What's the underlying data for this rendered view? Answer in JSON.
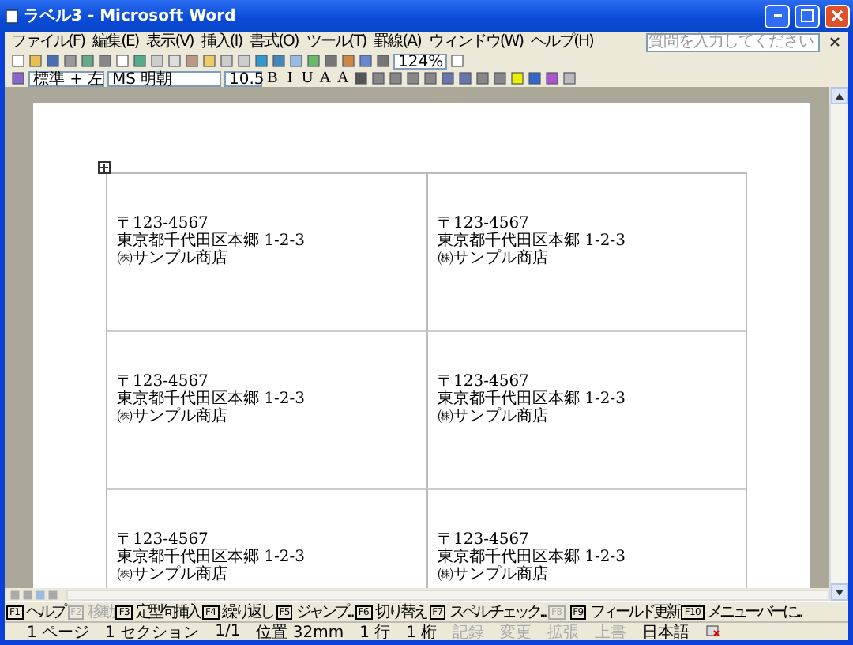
{
  "window": {
    "title": "ラベル3 - Microsoft Word"
  },
  "menu": [
    "ファイル(F)",
    "編集(E)",
    "表示(V)",
    "挿入(I)",
    "書式(O)",
    "ツール(T)",
    "罫線(A)",
    "ウィンドウ(W)",
    "ヘルプ(H)"
  ],
  "help_search": {
    "placeholder": "質問を入力してください"
  },
  "standard_toolbar": {
    "zoom": "124%"
  },
  "formatting_toolbar": {
    "style": "標準 + 左",
    "font": "MS 明朝",
    "size": "10.5",
    "buttons": [
      "B",
      "I",
      "U",
      "A",
      "A"
    ]
  },
  "labels": [
    {
      "lines": [
        "〒123-4567",
        "東京都千代田区本郷 1-2-3",
        "㈱サンプル商店"
      ]
    },
    {
      "lines": [
        "〒123-4567",
        "東京都千代田区本郷 1-2-3",
        "㈱サンプル商店"
      ]
    },
    {
      "lines": [
        "〒123-4567",
        "東京都千代田区本郷 1-2-3",
        "㈱サンプル商店"
      ]
    },
    {
      "lines": [
        "〒123-4567",
        "東京都千代田区本郷 1-2-3",
        "㈱サンプル商店"
      ]
    },
    {
      "lines": [
        "〒123-4567",
        "東京都千代田区本郷 1-2-3",
        "㈱サンプル商店"
      ]
    },
    {
      "lines": [
        "〒123-4567",
        "東京都千代田区本郷 1-2-3",
        "㈱サンプル商店"
      ]
    }
  ],
  "function_keys": [
    {
      "key": "F1",
      "label": "ヘルプ",
      "disabled": false
    },
    {
      "key": "F2",
      "label": "移動",
      "disabled": true
    },
    {
      "key": "F3",
      "label": "定型句挿入",
      "disabled": false
    },
    {
      "key": "F4",
      "label": "繰り返し",
      "disabled": false
    },
    {
      "key": "F5",
      "label": "ジャンプ...",
      "disabled": false
    },
    {
      "key": "F6",
      "label": "切り替え",
      "disabled": false
    },
    {
      "key": "F7",
      "label": "スペル チェック...",
      "disabled": false
    },
    {
      "key": "F8",
      "disabled": true
    },
    {
      "key": "F9",
      "label": "フィールド更新",
      "disabled": false
    },
    {
      "key": "F10",
      "label": "メニューバーに...",
      "disabled": false
    }
  ],
  "status_bar": [
    {
      "text": "1 ページ",
      "disabled": false
    },
    {
      "text": "1 セクション",
      "disabled": false
    },
    {
      "text": "1/1",
      "disabled": false
    },
    {
      "text": "位置 32mm",
      "disabled": false
    },
    {
      "text": "1 行",
      "disabled": false
    },
    {
      "text": "1 桁",
      "disabled": false
    },
    {
      "text": "記録",
      "disabled": true
    },
    {
      "text": "変更",
      "disabled": true
    },
    {
      "text": "拡張",
      "disabled": true
    },
    {
      "text": "上書",
      "disabled": true
    },
    {
      "text": "日本語",
      "disabled": false
    }
  ]
}
